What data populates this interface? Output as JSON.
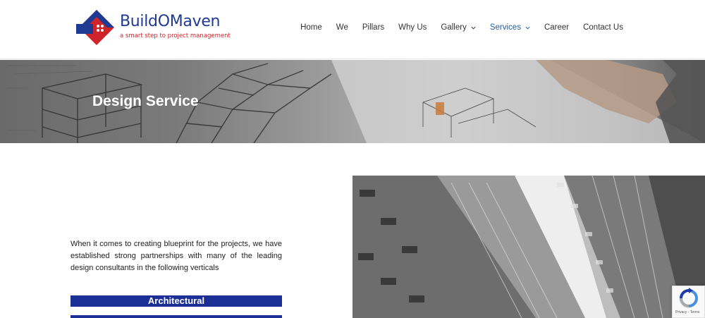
{
  "brand": {
    "name": "BuildOMaven",
    "tagline": "a smart step to project management",
    "primary_color": "#1f3a93",
    "accent_color": "#d0242b"
  },
  "nav": {
    "items": [
      {
        "label": "Home"
      },
      {
        "label": "We"
      },
      {
        "label": "Pillars"
      },
      {
        "label": "Why Us"
      },
      {
        "label": "Gallery",
        "has_dropdown": true
      },
      {
        "label": "Services",
        "has_dropdown": true,
        "active": true
      },
      {
        "label": "Career"
      },
      {
        "label": "Contact Us"
      }
    ],
    "active_color": "#1f5da8"
  },
  "banner": {
    "title": "Design Service"
  },
  "content": {
    "intro": "When it comes to creating blueprint for the projects, we have established strong partnerships with many of the leading design consultants in the following verticals",
    "verticals": [
      "Architectural"
    ],
    "vertical_bar_color": "#1b2f96"
  },
  "recaptcha": {
    "links": "Privacy - Terms"
  }
}
